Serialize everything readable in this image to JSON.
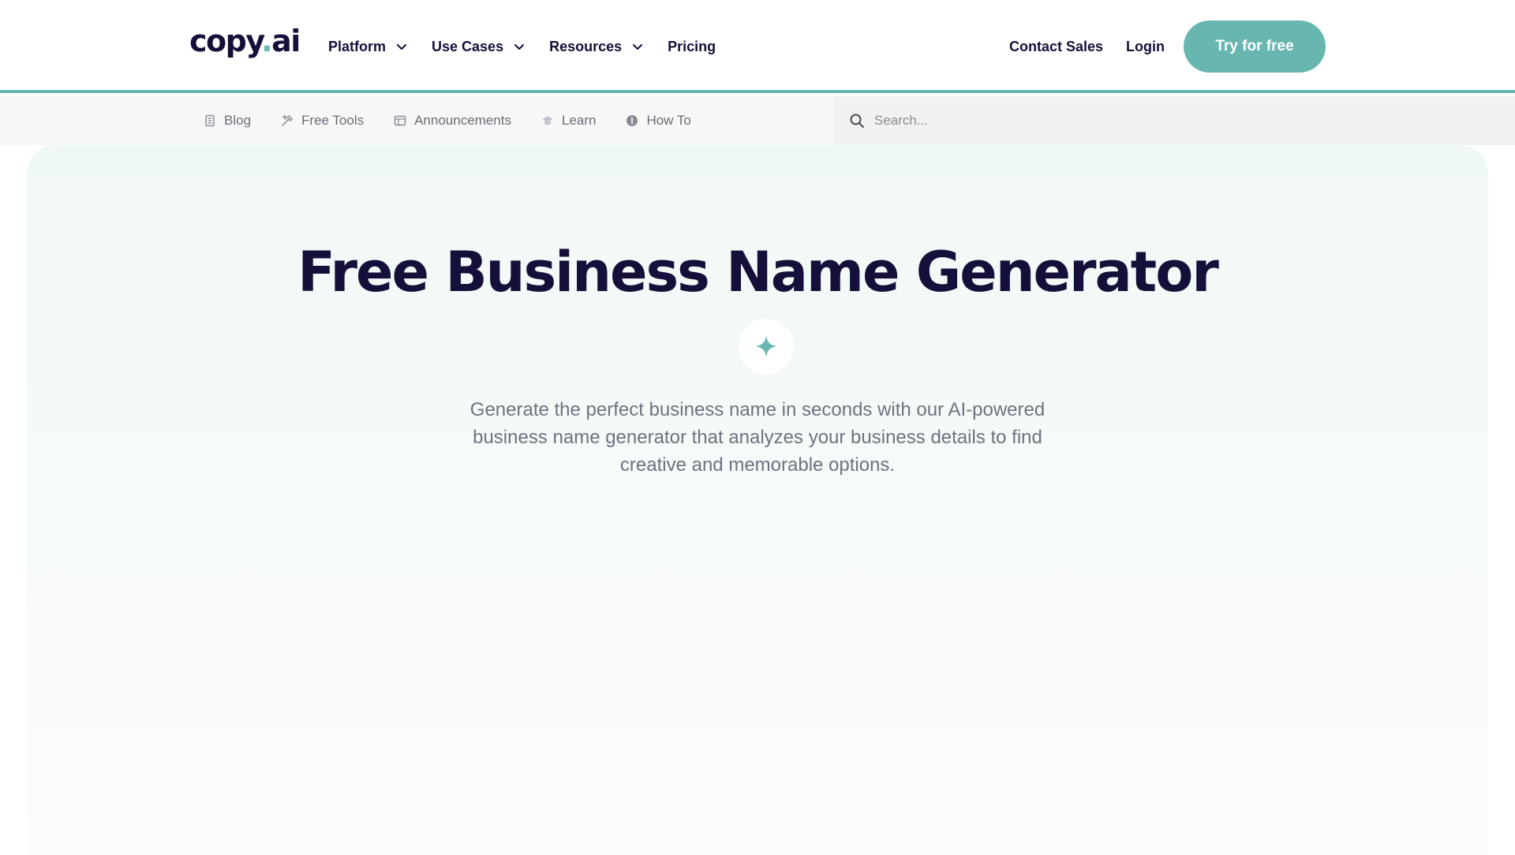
{
  "brand": {
    "logo_main": "copy",
    "logo_dot": ".",
    "logo_tail": "ai",
    "accent": "#67b7b0",
    "ink": "#14103a"
  },
  "topnav": {
    "items": [
      {
        "label": "Platform",
        "dropdown": true
      },
      {
        "label": "Use Cases",
        "dropdown": true
      },
      {
        "label": "Resources",
        "dropdown": true
      },
      {
        "label": "Pricing",
        "dropdown": false
      }
    ],
    "contact_sales": "Contact Sales",
    "login": "Login",
    "cta": "Try for free"
  },
  "subnav": {
    "items": [
      {
        "label": "Blog",
        "icon": "document-icon"
      },
      {
        "label": "Free Tools",
        "icon": "tools-icon"
      },
      {
        "label": "Announcements",
        "icon": "newspaper-icon"
      },
      {
        "label": "Learn",
        "icon": "graduation-cap-icon"
      },
      {
        "label": "How To",
        "icon": "info-circle-icon"
      }
    ],
    "search_placeholder": "Search..."
  },
  "hero": {
    "title": "Free Business Name Generator",
    "icon": "sparkle-icon",
    "description": "Generate the perfect business name in seconds with our AI-powered business name generator that analyzes your business details to find creative and memorable options."
  }
}
